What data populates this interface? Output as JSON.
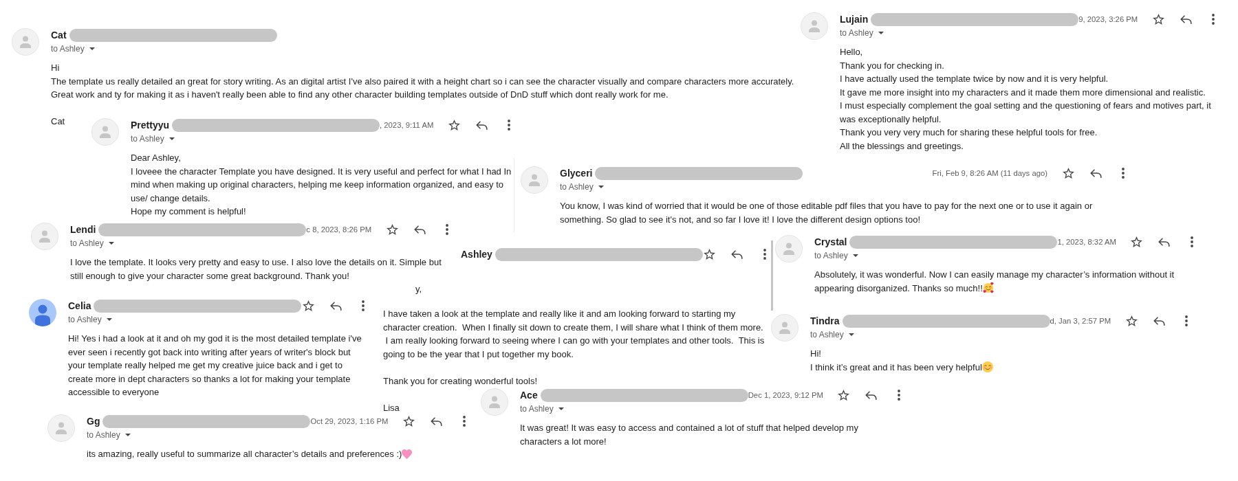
{
  "messages": [
    {
      "sender": "Cat",
      "avatar": {
        "kind": "placeholder"
      },
      "recipient": "to Ashley",
      "body": [
        [
          "Hi",
          "The template us really detailed an great for story writing. As an digital artist I've also paired it with a height chart so i can see the character visually and compare characters more accurately.",
          "Great work and ty for making it as i haven't really been able to find any other character building templates outside of DnD stuff which dont really work for me."
        ],
        [
          "Cat"
        ]
      ]
    },
    {
      "sender": "Lujain",
      "avatar": {
        "kind": "placeholder"
      },
      "date": "9, 2023, 3:26 PM",
      "toolbar": {
        "starred": false
      },
      "recipient": "to Ashley",
      "body": [
        [
          "Hello,",
          "Thank you for checking in.",
          "I have actually used the template twice by now and it is very helpful.",
          "It gave me more insight into my characters and it made them more dimensional and realistic.",
          "I must especially complement the goal setting and the questioning of fears and motives part, it was exceptionally helpful.",
          "Thank you very very much for sharing these helpful tools for free.",
          "All the blessings and greetings."
        ]
      ]
    },
    {
      "sender": "Prettyyu",
      "avatar": {
        "kind": "placeholder"
      },
      "date": ", 2023, 9:11 AM",
      "toolbar": {
        "starred": false
      },
      "recipient": "to Ashley",
      "body": [
        [
          "Dear Ashley,",
          "I loveee the character Template you have designed. It is very useful and perfect for what I had In mind when making up original characters, helping me keep information organized, and easy to use/ change details.",
          "Hope my comment is helpful!"
        ]
      ]
    },
    {
      "sender": "Glyceri",
      "avatar": {
        "kind": "placeholder"
      },
      "date": "Fri, Feb 9, 8:26 AM (11 days ago)",
      "toolbar": {
        "starred": false
      },
      "recipient": "to Ashley",
      "body": [
        [
          "You know, I was kind of worried that it would be one of those editable pdf files that you have to pay for the next one or to use it again or something. So glad to see it's not, and so far I love it! I love the different design options too!"
        ]
      ]
    },
    {
      "sender": "Lendi",
      "avatar": {
        "kind": "placeholder"
      },
      "date": "c 8, 2023, 8:26 PM",
      "toolbar": {
        "starred": false
      },
      "recipient": "to Ashley",
      "body": [
        [
          "I love the template. It looks very pretty and easy to use. I also love the details on it. Simple but still enough to give your character some great background. Thank you!"
        ]
      ]
    },
    {
      "sender": "Crystal",
      "avatar": {
        "kind": "placeholder"
      },
      "date": "1, 2023, 8:32 AM",
      "toolbar": {
        "starred": false
      },
      "recipient": "to Ashley",
      "body": [
        [
          "Absolutely, it was wonderful. Now I can easily manage my character’s information without it",
          "appearing disorganized. Thanks so much!!"
        ]
      ],
      "end_icon": {
        "kind": "hearts"
      }
    },
    {
      "sender": "Ashley",
      "toolbar": {
        "starred": false
      }
    },
    {
      "body": [
        [
          "y,"
        ]
      ]
    },
    {
      "body": [
        [
          "I have taken a look at the template and really like it and am looking forward to starting my character creation.  When I finally sit down to create them, I will share what I think of them more.  I am really looking forward to seeing where I can go with your templates and other tools.  This is going to be the year that I put together my book."
        ],
        [
          "Thank you for creating wonderful tools!"
        ],
        [
          "Lisa"
        ]
      ]
    },
    {
      "sender": "Celia",
      "avatar": {
        "kind": "account"
      },
      "toolbar": {
        "starred": false
      },
      "recipient": "to Ashley",
      "body": [
        [
          "Hi! Yes i had a look at it and oh my god it is the most detailed template i've ever seen i recently got back into writing after years of writer's block but your template really helped me get my creative juice back and i get to create more in dept characters so thanks a lot for making your template accessible to everyone"
        ]
      ]
    },
    {
      "sender": "Tindra",
      "avatar": {
        "kind": "placeholder"
      },
      "date": "d, Jan 3, 2:57 PM",
      "toolbar": {
        "starred": false
      },
      "recipient": "to Ashley",
      "body": [
        [
          "Hi!",
          "I think it’s great and it has been very helpful"
        ]
      ],
      "end_icon": {
        "kind": "blush"
      }
    },
    {
      "sender": "Ace",
      "avatar": {
        "kind": "placeholder"
      },
      "date": "Dec 1, 2023, 9:12 PM",
      "toolbar": {
        "starred": false
      },
      "recipient": "to Ashley",
      "body": [
        [
          "It was great! It was easy to access and contained a lot of stuff that helped develop my characters a lot more!"
        ]
      ]
    },
    {
      "sender": "Gg",
      "avatar": {
        "kind": "placeholder"
      },
      "date": "Oct 29, 2023, 1:16 PM",
      "toolbar": {
        "starred": false
      },
      "recipient": "to Ashley",
      "body": [
        [
          "its amazing, really useful to summarize all character’s details and preferences :)"
        ]
      ],
      "end_icon": {
        "kind": "heart"
      }
    }
  ]
}
